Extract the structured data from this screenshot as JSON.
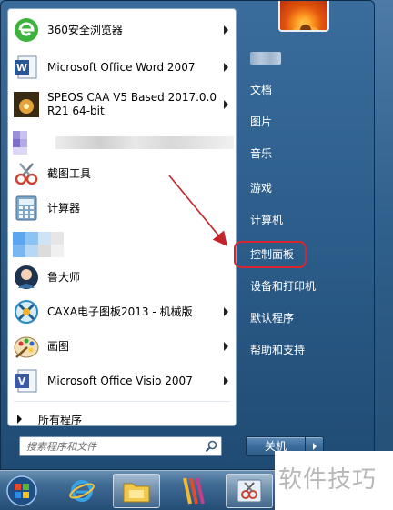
{
  "left_pane": {
    "programs": [
      {
        "label": "360安全浏览器",
        "icon": "360-browser-icon",
        "has_arrow": true
      },
      {
        "label": "Microsoft Office Word 2007",
        "icon": "word-icon",
        "has_arrow": true
      },
      {
        "label": "SPEOS CAA V5 Based 2017.0.0 R21 64-bit",
        "icon": "speos-icon",
        "has_arrow": true
      },
      {
        "label": "",
        "icon": "pixelated-icon",
        "has_arrow": false
      },
      {
        "label": "截图工具",
        "icon": "snipping-tool-icon",
        "has_arrow": false
      },
      {
        "label": "计算器",
        "icon": "calculator-icon",
        "has_arrow": false
      },
      {
        "label": "",
        "icon": "pixelated-icon",
        "has_arrow": false
      },
      {
        "label": "鲁大师",
        "icon": "ludashi-icon",
        "has_arrow": false
      },
      {
        "label": "CAXA电子图板2013 - 机械版",
        "icon": "caxa-icon",
        "has_arrow": true
      },
      {
        "label": "画图",
        "icon": "paint-icon",
        "has_arrow": true
      },
      {
        "label": "Microsoft Office Visio 2007",
        "icon": "visio-icon",
        "has_arrow": true
      }
    ],
    "all_programs": "所有程序"
  },
  "search": {
    "placeholder": "搜索程序和文件"
  },
  "right_pane": {
    "items": [
      "文档",
      "图片",
      "音乐",
      "游戏",
      "计算机",
      "控制面板",
      "设备和打印机",
      "默认程序",
      "帮助和支持"
    ],
    "highlighted": "控制面板"
  },
  "shutdown": {
    "label": "关机"
  },
  "watermark": "软件技巧",
  "colors": {
    "highlight": "#d8262e",
    "arrow": "#c4252a"
  }
}
